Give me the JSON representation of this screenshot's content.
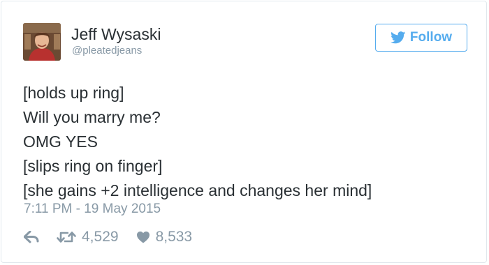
{
  "tweet": {
    "author": {
      "name": "Jeff Wysaski",
      "handle": "@pleatedjeans"
    },
    "follow_label": "Follow",
    "lines": [
      "[holds up ring]",
      "Will you marry me?",
      "OMG YES",
      "[slips ring on finger]",
      "[she gains +2 intelligence and changes her mind]"
    ],
    "timestamp": "7:11 PM - 19 May 2015",
    "retweets": "4,529",
    "likes": "8,533"
  },
  "colors": {
    "accent": "#55acee",
    "text": "#292f33",
    "muted": "#8899a6",
    "border": "#e1e8ed"
  },
  "icons": {
    "bird": "twitter-bird-icon",
    "reply": "reply-icon",
    "retweet": "retweet-icon",
    "like": "heart-icon"
  }
}
